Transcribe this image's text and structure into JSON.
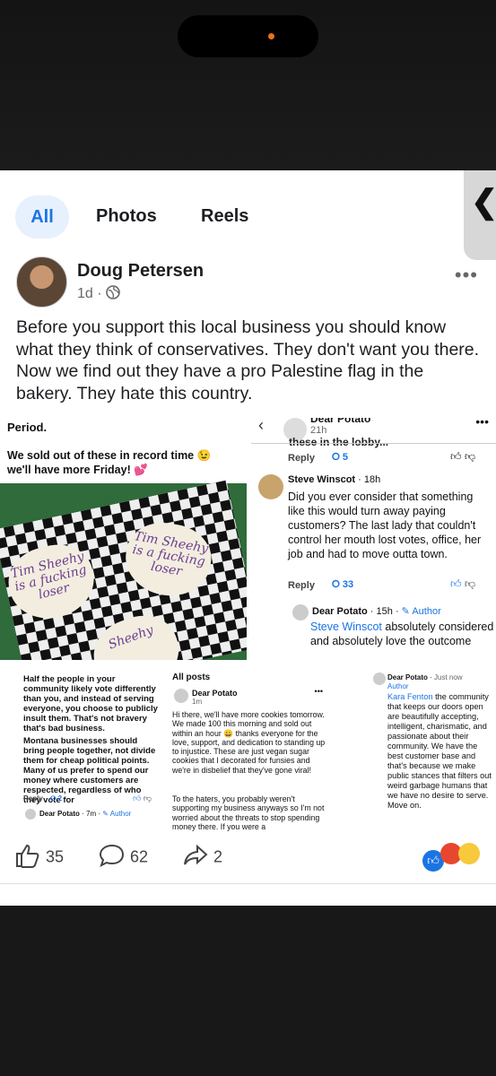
{
  "tabs": [
    "All",
    "Photos",
    "Reels"
  ],
  "post": {
    "author": "Doug Petersen",
    "time": "1d",
    "text": "Before you support this local business you should know what they think of conservatives. They don't want you there. Now we find out they have a pro Palestine flag in the bakery. They hate this country."
  },
  "screenshot1": {
    "line1": "Period.",
    "line2": "We sold out of these in record time 😉 we'll have more Friday! 💕",
    "cookie1": "Tim Sheehy is a fucking loser",
    "cookie2": "Tim Sheehy is a fucking loser",
    "cookie3": "Sheehy"
  },
  "screenshot2": {
    "header_name": "Dear Potato",
    "header_time": "21h",
    "cut_text": "these in the lobby...",
    "reply": "Reply",
    "count1": "5",
    "commenter": "Steve Winscot",
    "comment_time": "18h",
    "comment_text": "Did you ever consider that something like this would turn away paying customers? The last lady that couldn't control her mouth lost votes, office, her job and had to move outta town.",
    "count2": "33",
    "reply_author": "Dear Potato",
    "reply_time": "15h",
    "reply_badge": "Author",
    "reply_mention": "Steve Winscot",
    "reply_text": " absolutely considered and absolutely love the outcome"
  },
  "screenshot3": {
    "text1": "Half the people in your community likely vote differently than you, and instead of serving everyone, you choose to publicly insult them. That's not bravery that's bad business.",
    "text2": "Montana businesses should bring people together, not divide them for cheap political points. Many of us prefer to spend our money where customers are respected, regardless of who they vote for",
    "reply": "Reply",
    "count": "2",
    "reply_author": "Dear Potato",
    "reply_time": "7m",
    "reply_badge": "Author"
  },
  "screenshot4": {
    "header": "All posts",
    "author": "Dear Potato",
    "time": "1m",
    "text1": "Hi there, we'll have more cookies tomorrow. We made 100 this morning and sold out within an hour 😀 thanks everyone for the love, support, and dedication to standing up to injustice. These are just vegan sugar cookies that I decorated for funsies and we're in disbelief that they've gone viral!",
    "text2": "To the haters, you probably weren't supporting my business anyways so I'm not worried about the threats to stop spending money there. If you were a"
  },
  "screenshot5": {
    "author": "Dear Potato",
    "time": "Just now",
    "badge": "Author",
    "mention": "Kara Fenton",
    "text": " the community that keeps our doors open are beautifully accepting, intelligent, charismatic, and passionate about their community. We have the best customer base and that's because we make public stances that filters out weird garbage humans that we have no desire to serve. Move on."
  },
  "reactions": {
    "likes": "35",
    "comments": "62",
    "shares": "2"
  }
}
